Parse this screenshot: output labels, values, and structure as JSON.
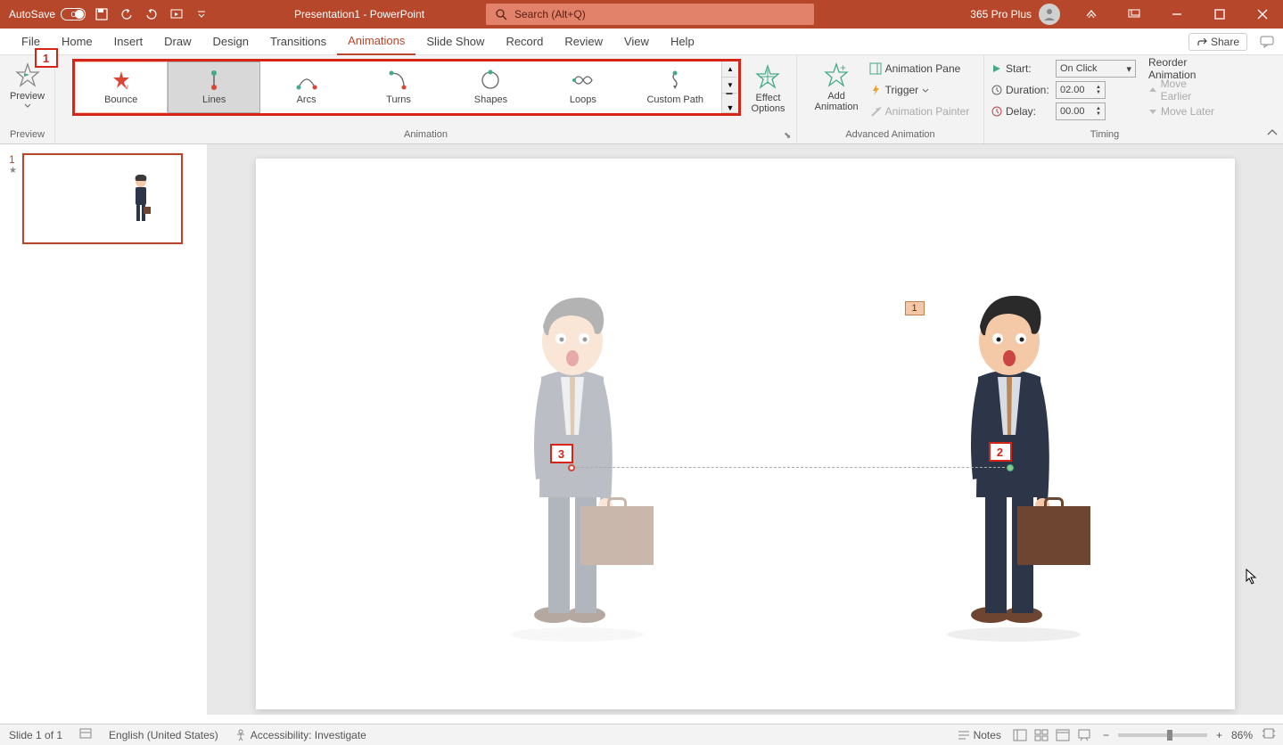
{
  "titlebar": {
    "autosave_label": "AutoSave",
    "autosave_state": "Off",
    "title": "Presentation1 - PowerPoint",
    "search_placeholder": "Search (Alt+Q)",
    "plan": "365 Pro Plus"
  },
  "tabs": {
    "file": "File",
    "home": "Home",
    "insert": "Insert",
    "draw": "Draw",
    "design": "Design",
    "transitions": "Transitions",
    "animations": "Animations",
    "slideshow": "Slide Show",
    "record": "Record",
    "review": "Review",
    "view": "View",
    "help": "Help",
    "share": "Share"
  },
  "ribbon": {
    "preview": {
      "label": "Preview",
      "group_label": "Preview"
    },
    "gallery": {
      "items": [
        "Bounce",
        "Lines",
        "Arcs",
        "Turns",
        "Shapes",
        "Loops",
        "Custom Path"
      ],
      "group_label": "Animation"
    },
    "effect_options": "Effect\nOptions",
    "advanced": {
      "add_animation": "Add\nAnimation",
      "animation_pane": "Animation Pane",
      "trigger": "Trigger",
      "animation_painter": "Animation Painter",
      "group_label": "Advanced Animation"
    },
    "timing": {
      "start_label": "Start:",
      "start_value": "On Click",
      "duration_label": "Duration:",
      "duration_value": "02.00",
      "delay_label": "Delay:",
      "delay_value": "00.00",
      "reorder": "Reorder Animation",
      "move_earlier": "Move Earlier",
      "move_later": "Move Later",
      "group_label": "Timing"
    }
  },
  "markers": {
    "m1": "1",
    "m2": "2",
    "m3": "3"
  },
  "canvas": {
    "anim_tag": "1"
  },
  "slidepanel": {
    "slide_num": "1"
  },
  "statusbar": {
    "slide_info": "Slide 1 of 1",
    "language": "English (United States)",
    "accessibility": "Accessibility: Investigate",
    "notes": "Notes",
    "zoom": "86%"
  }
}
